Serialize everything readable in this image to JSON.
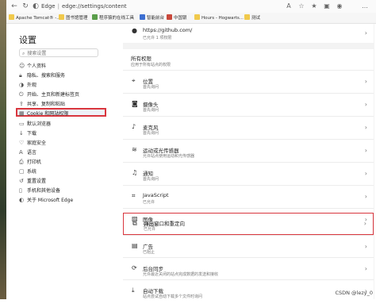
{
  "address_bar": {
    "back_icon": "back-arrow-icon",
    "refresh_icon": "refresh-icon",
    "browser": "Edge",
    "url": "edge://settings/content"
  },
  "bookmarks": [
    {
      "label": "Apache Tomcat® -...",
      "color": "#f0c94c"
    },
    {
      "label": "图书馆管理",
      "color": "#f0c94c"
    },
    {
      "label": "程序猿的在线工具",
      "color": "#5a9e4a"
    },
    {
      "label": "智能前台",
      "color": "#3d6fd1"
    },
    {
      "label": "中国银",
      "color": "#c9483b"
    },
    {
      "label": "Hours - Hogwarts...",
      "color": "#f0c94c"
    },
    {
      "label": "测试",
      "color": "#f0c94c"
    }
  ],
  "sidebar": {
    "title": "设置",
    "search_placeholder": "搜索设置",
    "items": [
      {
        "icon": "person-icon",
        "label": "个人资料"
      },
      {
        "icon": "lock-icon",
        "label": "隐私、搜索和服务"
      },
      {
        "icon": "appearance-icon",
        "label": "外观"
      },
      {
        "icon": "power-icon",
        "label": "开始、主页和新建标签页"
      },
      {
        "icon": "share-icon",
        "label": "共享、复制和粘贴"
      },
      {
        "icon": "cookie-site-icon",
        "label": "Cookie 和网站权限"
      },
      {
        "icon": "browser-icon",
        "label": "默认浏览器"
      },
      {
        "icon": "download-icon",
        "label": "下载"
      },
      {
        "icon": "family-icon",
        "label": "家庭安全"
      },
      {
        "icon": "language-icon",
        "label": "语言"
      },
      {
        "icon": "printer-icon",
        "label": "打印机"
      },
      {
        "icon": "system-icon",
        "label": "系统"
      },
      {
        "icon": "reset-icon",
        "label": "重置设置"
      },
      {
        "icon": "phone-icon",
        "label": "手机和其他设备"
      },
      {
        "icon": "edge-icon",
        "label": "关于 Microsoft Edge"
      }
    ]
  },
  "content": {
    "github": {
      "icon": "github-icon",
      "title": "https://github.com/",
      "sub": "已允许 1 项权限"
    },
    "section": {
      "title": "所有权限",
      "sub": "应用于所有站点的权限"
    },
    "permissions": [
      {
        "icon": "location-icon",
        "title": "位置",
        "sub": "首先询问"
      },
      {
        "icon": "camera-icon",
        "title": "摄像头",
        "sub": "首先询问"
      },
      {
        "icon": "microphone-icon",
        "title": "麦克风",
        "sub": "首先询问"
      },
      {
        "icon": "motion-sensor-icon",
        "title": "运动或光传感器",
        "sub": "允许站点使用运动和光传感器"
      },
      {
        "icon": "bell-icon",
        "title": "通知",
        "sub": "首先询问"
      },
      {
        "icon": "javascript-icon",
        "title": "JavaScript",
        "sub": "已允许"
      },
      {
        "icon": "image-icon",
        "title": "图像",
        "sub": "全部显示"
      },
      {
        "icon": "popup-icon",
        "title": "弹出窗口和重定向",
        "sub": "已允许"
      },
      {
        "icon": "ads-icon",
        "title": "广告",
        "sub": "已阻止"
      },
      {
        "icon": "sync-icon",
        "title": "后台同步",
        "sub": "允许最近关闭的站点完成数据的发送和接收"
      },
      {
        "icon": "auto-download-icon",
        "title": "自动下载",
        "sub": "站点尝试自动下载多个文件时询问"
      }
    ]
  },
  "watermark": "CSDN @lezy_0",
  "colors": {
    "highlight": "#d9363e"
  }
}
